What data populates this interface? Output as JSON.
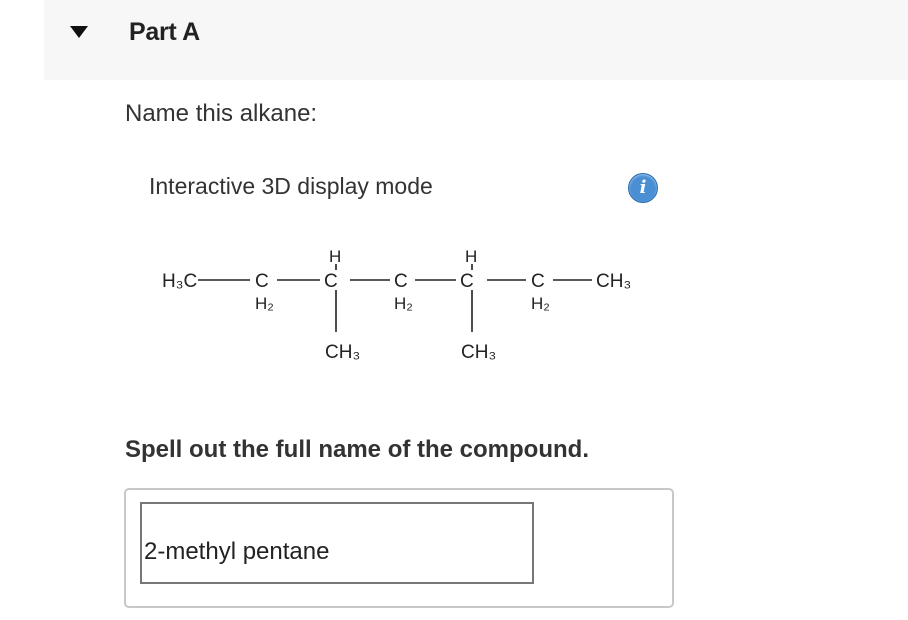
{
  "part": {
    "title": "Part A",
    "toggle_icon": "triangle-down-icon"
  },
  "question": {
    "prompt": "Name this alkane:",
    "display_mode_label": "Interactive 3D display mode",
    "info_icon": "info-icon",
    "info_glyph": "i"
  },
  "structure": {
    "chain_left": "H₃C",
    "c1": "C",
    "c1_h": "H₂",
    "c2": "C",
    "c2_top_h": "H",
    "c2_branch": "CH₃",
    "c3": "C",
    "c3_h": "H₂",
    "c4": "C",
    "c4_top_h": "H",
    "c4_branch": "CH₃",
    "c5": "C",
    "c5_h": "H₂",
    "chain_right": "CH₃"
  },
  "answer": {
    "instruction": "Spell out the full name of the compound.",
    "value": "2-methyl pentane"
  },
  "colors": {
    "header_bg": "#f7f7f7",
    "info_icon": "#4a8fd4",
    "text": "#333333"
  }
}
